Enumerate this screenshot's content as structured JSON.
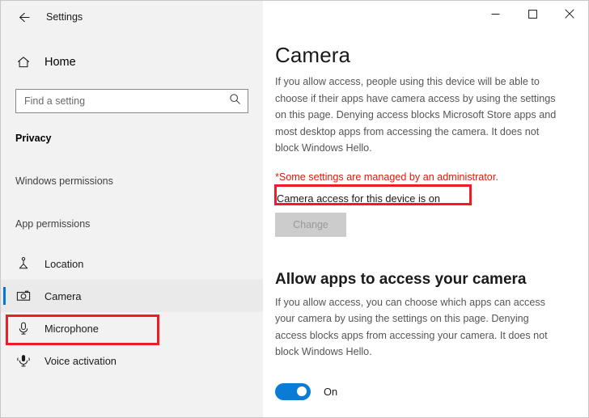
{
  "window": {
    "app_title": "Settings",
    "back_icon": "back-arrow-icon",
    "controls": {
      "minimize": "minimize-icon",
      "maximize": "maximize-icon",
      "close": "close-icon"
    }
  },
  "sidebar": {
    "home": {
      "label": "Home",
      "icon": "home-icon"
    },
    "search": {
      "placeholder": "Find a setting",
      "value": "",
      "icon": "search-icon"
    },
    "section_title": "Privacy",
    "groups": [
      {
        "label": "Windows permissions"
      },
      {
        "label": "App permissions"
      }
    ],
    "items": [
      {
        "label": "Location",
        "icon": "location-icon",
        "selected": false
      },
      {
        "label": "Camera",
        "icon": "camera-icon",
        "selected": true
      },
      {
        "label": "Microphone",
        "icon": "microphone-icon",
        "selected": false
      },
      {
        "label": "Voice activation",
        "icon": "voice-activation-icon",
        "selected": false
      }
    ]
  },
  "main": {
    "title": "Camera",
    "description": "If you allow access, people using this device will be able to choose if their apps have camera access by using the settings on this page. Denying access blocks Microsoft Store apps and most desktop apps from accessing the camera. It does not block Windows Hello.",
    "admin_note": "*Some settings are managed by an administrator.",
    "device_access_status": "Camera access for this device is on",
    "change_button": {
      "label": "Change",
      "disabled": true
    },
    "apps_section": {
      "heading": "Allow apps to access your camera",
      "description": "If you allow access, you can choose which apps can access your camera by using the settings on this page. Denying access blocks apps from accessing your camera. It does not block Windows Hello.",
      "toggle": {
        "state": "On",
        "label": "On",
        "on": true
      }
    }
  },
  "annotations": {
    "color": "#ee1c25",
    "boxes": [
      {
        "name": "device-access-status-highlight"
      },
      {
        "name": "camera-nav-item-highlight"
      }
    ]
  },
  "colors": {
    "accent": "#0078d4",
    "toggle_on": "#0a7cd6",
    "warning_red": "#e3170a",
    "annotation_red": "#ee1c25",
    "sidebar_bg": "#f2f2f2",
    "main_bg": "#ffffff"
  }
}
